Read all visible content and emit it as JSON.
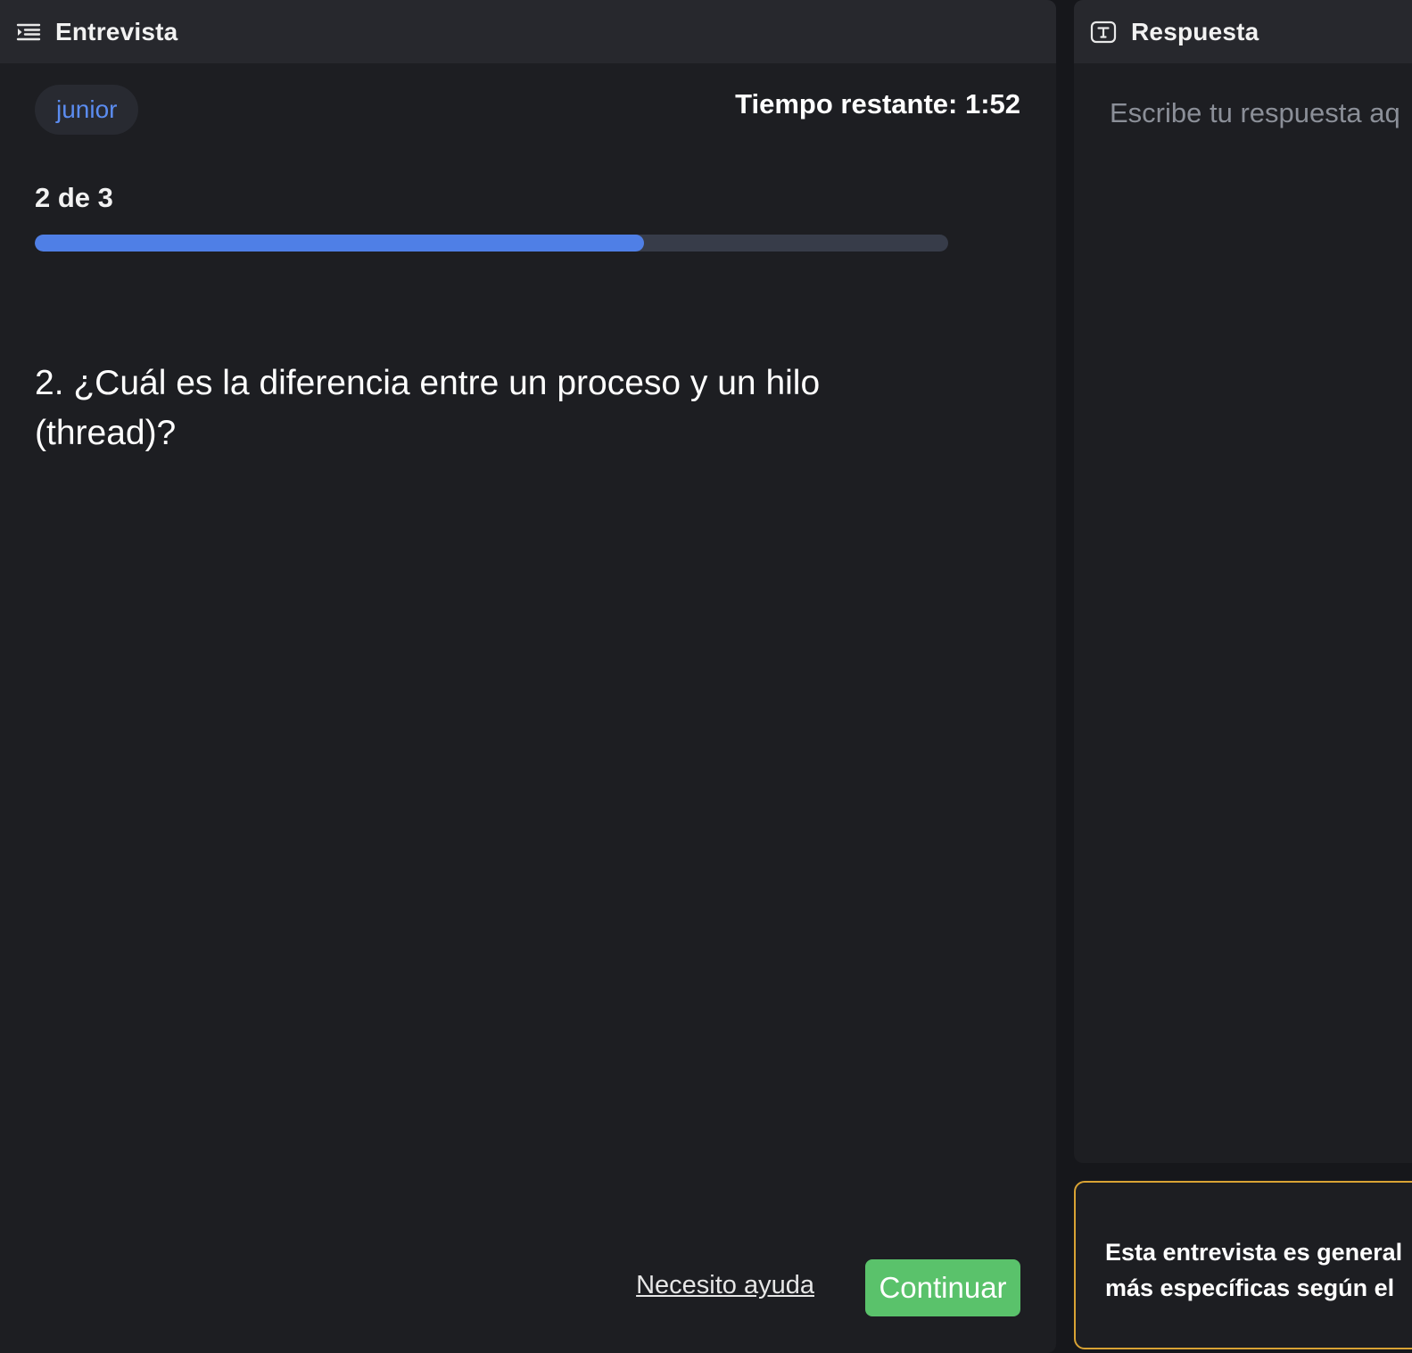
{
  "colors": {
    "accent_blue": "#4f7fe6",
    "badge_text": "#5b8cf0",
    "continue_green": "#5ac26b",
    "notice_border": "#d9a334",
    "panel_bg": "#1d1e22",
    "header_bg": "#27282d"
  },
  "interview_panel": {
    "title": "Entrevista",
    "icon": "indent-list-icon",
    "level_badge": "junior",
    "timer": "Tiempo restante: 1:52",
    "progress": {
      "label": "2 de 3",
      "fraction": 0.667
    },
    "question": "2. ¿Cuál es la diferencia entre un proceso y un hilo (thread)?",
    "help_link": "Necesito ayuda",
    "continue_label": "Continuar"
  },
  "answer_panel": {
    "title": "Respuesta",
    "icon": "text-box-icon",
    "placeholder": "Escribe tu respuesta aq"
  },
  "notice": {
    "text_line1": "Esta entrevista es general",
    "text_line2": "más específicas según el"
  }
}
